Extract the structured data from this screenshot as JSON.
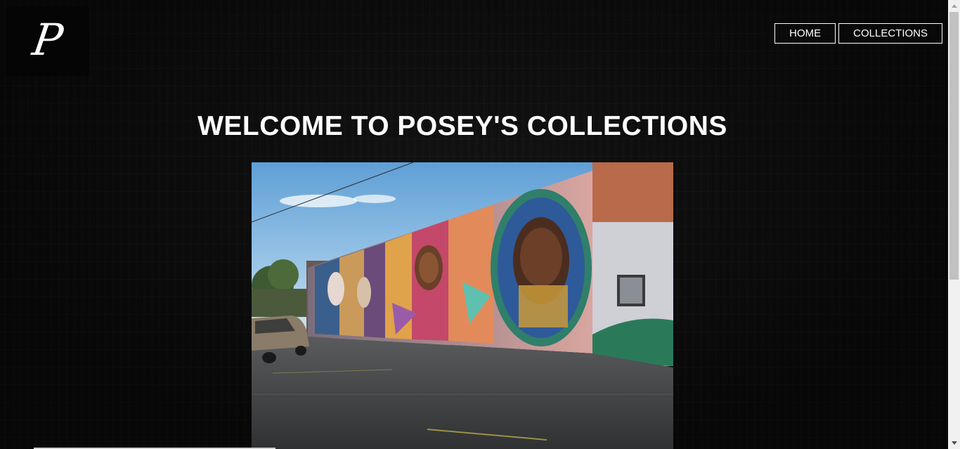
{
  "logo": {
    "letter": "P"
  },
  "nav": {
    "home_label": "HOME",
    "collections_label": "COLLECTIONS"
  },
  "main": {
    "title": "WELCOME TO POSEY'S COLLECTIONS"
  },
  "colors": {
    "background": "#0c0c0c",
    "text": "#ffffff",
    "nav_border": "#ffffff"
  },
  "icons": {
    "scroll_up": "chevron-up-icon",
    "scroll_down": "chevron-down-icon"
  }
}
